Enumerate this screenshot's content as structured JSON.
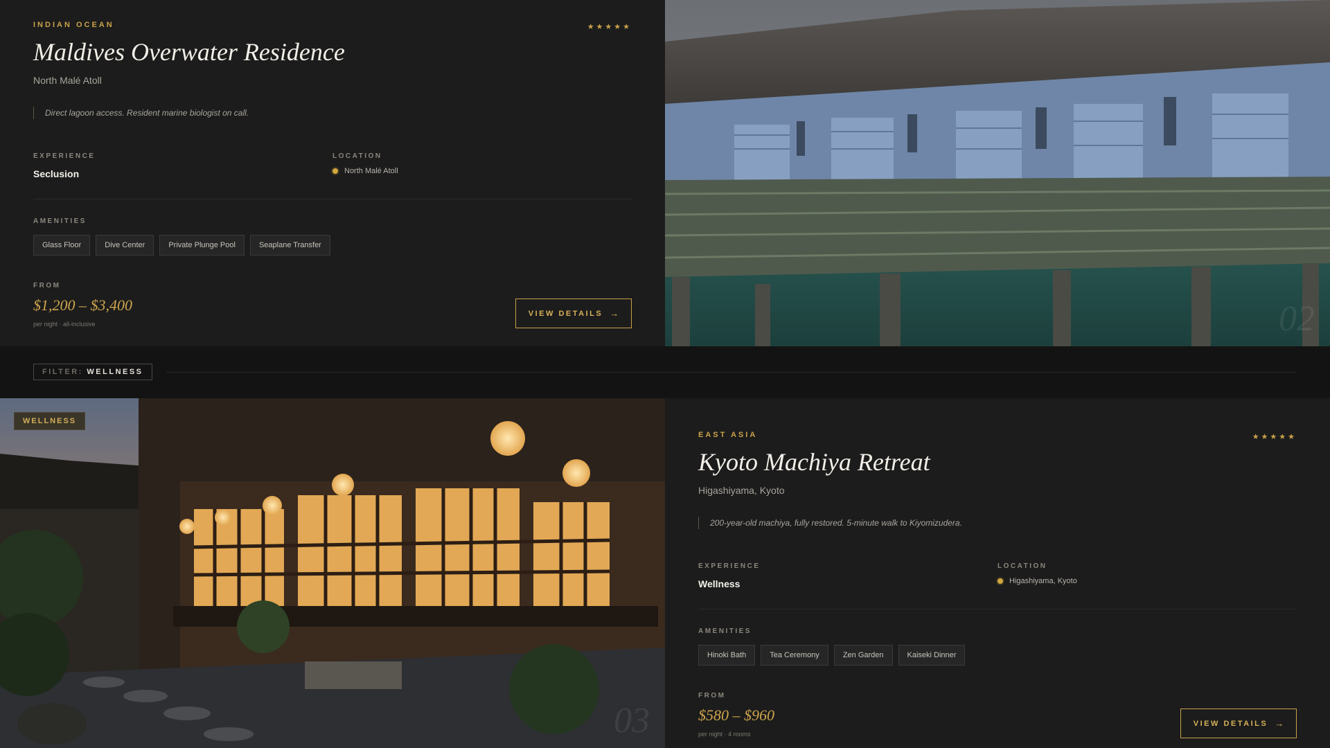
{
  "listings": [
    {
      "region": "INDIAN OCEAN",
      "stars": "★★★★★",
      "title": "Maldives Overwater Residence",
      "subtitle": "North Malé Atoll",
      "quote": "Direct lagoon access. Resident marine biologist on call.",
      "experience_label": "EXPERIENCE",
      "experience": "Seclusion",
      "location_label": "LOCATION",
      "location": "North Malé Atoll",
      "amenities_label": "AMENITIES",
      "amenities": [
        "Glass Floor",
        "Dive Center",
        "Private Plunge Pool",
        "Seaplane Transfer"
      ],
      "from_label": "FROM",
      "price": "$1,200 – $3,400",
      "price_note": "per night · all-inclusive",
      "button": "VIEW DETAILS",
      "index": "02"
    },
    {
      "region": "EAST ASIA",
      "stars": "★★★★★",
      "title": "Kyoto Machiya Retreat",
      "subtitle": "Higashiyama, Kyoto",
      "quote": "200-year-old machiya, fully restored. 5-minute walk to Kiyomizudera.",
      "experience_label": "EXPERIENCE",
      "experience": "Wellness",
      "location_label": "LOCATION",
      "location": "Higashiyama, Kyoto",
      "amenities_label": "AMENITIES",
      "amenities": [
        "Hinoki Bath",
        "Tea Ceremony",
        "Zen Garden",
        "Kaiseki Dinner"
      ],
      "from_label": "FROM",
      "price": "$580 – $960",
      "price_note": "per night · 4 rooms",
      "button": "VIEW DETAILS",
      "tag": "WELLNESS",
      "index": "03"
    }
  ],
  "filter": {
    "key": "FILTER:",
    "value": "WELLNESS"
  },
  "colors": {
    "accent": "#c9a24a",
    "background": "#1c1c1c"
  },
  "icons": {
    "arrow": "→",
    "dot": "location-dot-icon"
  }
}
